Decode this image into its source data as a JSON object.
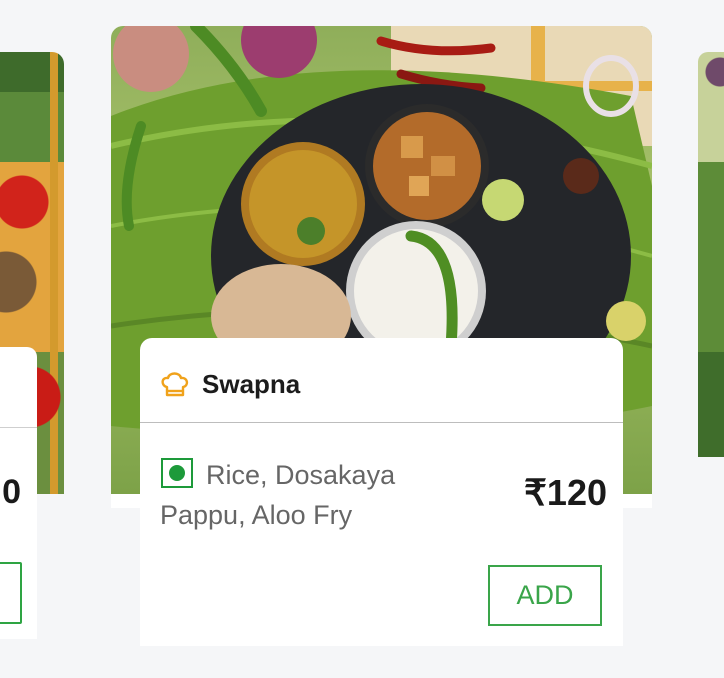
{
  "cards": [
    {
      "position": "left-partial",
      "price_fragment": "0"
    },
    {
      "position": "main",
      "icons": {
        "chef": "chef-hat-icon",
        "diet": "veg-indicator-icon"
      },
      "chef_name": "Swapna",
      "dish_description": "Rice, Dosakaya Pappu, Aloo Fry",
      "price": "₹120",
      "add_label": "ADD",
      "colors": {
        "veg_green": "#1d9a3a",
        "add_green": "#3aa54a",
        "chef_icon_orange": "#f0a21b"
      }
    },
    {
      "position": "right-partial"
    }
  ]
}
